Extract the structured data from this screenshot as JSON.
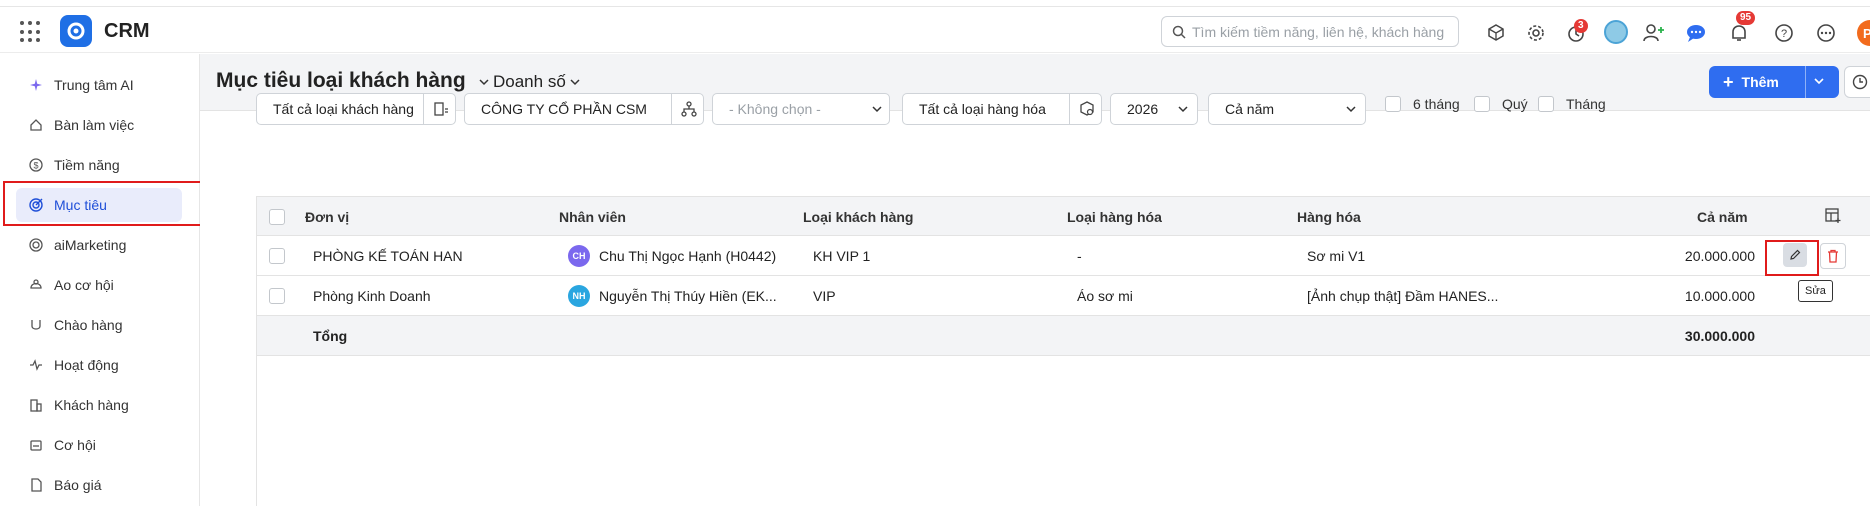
{
  "app": {
    "name": "CRM"
  },
  "search": {
    "placeholder": "Tìm kiếm tiềm năng, liên hệ, khách hàng"
  },
  "header_badges": {
    "timer": "3",
    "notifications": "95"
  },
  "user": {
    "initial": "P"
  },
  "sidebar": {
    "items": [
      {
        "label": "Trung tâm AI",
        "icon": "sparkle-icon"
      },
      {
        "label": "Bàn làm việc",
        "icon": "home-icon"
      },
      {
        "label": "Tiềm năng",
        "icon": "dollar-circle-icon"
      },
      {
        "label": "Mục tiêu",
        "icon": "target-icon",
        "active": true
      },
      {
        "label": "aiMarketing",
        "icon": "marketing-icon"
      },
      {
        "label": "Ao cơ hội",
        "icon": "pool-icon"
      },
      {
        "label": "Chào hàng",
        "icon": "offer-icon"
      },
      {
        "label": "Hoạt động",
        "icon": "activity-icon"
      },
      {
        "label": "Khách hàng",
        "icon": "building-icon"
      },
      {
        "label": "Cơ hội",
        "icon": "opportunity-icon"
      },
      {
        "label": "Báo giá",
        "icon": "quote-icon"
      }
    ]
  },
  "page": {
    "title": "Mục tiêu loại khách hàng",
    "metric": "Doanh số",
    "add_label": "Thêm"
  },
  "filters": {
    "customer_type": "Tất cả loại khách hàng",
    "company": "CÔNG TY CỔ PHẦN CSM",
    "unit_placeholder": "- Không chọn -",
    "product_type": "Tất cả loại hàng hóa",
    "year": "2026",
    "period": "Cả năm",
    "six_months": "6 tháng",
    "quarter": "Quý",
    "month": "Tháng"
  },
  "table": {
    "columns": [
      "Đơn vị",
      "Nhân viên",
      "Loại khách hàng",
      "Loại hàng hóa",
      "Hàng hóa",
      "Cả năm"
    ],
    "rows": [
      {
        "unit": "PHÒNG KẾ TOÁN HAN",
        "employee_initials": "CH",
        "employee": "Chu Thị Ngọc Hạnh (H0442)",
        "customer_type": "KH VIP 1",
        "product_type": "-",
        "product": "Sơ mi V1",
        "year_total": "20.000.000",
        "avatar_color": "#7b68ee"
      },
      {
        "unit": "Phòng Kinh Doanh",
        "employee_initials": "NH",
        "employee": "Nguyễn Thị Thúy Hiền (EK...",
        "customer_type": "VIP",
        "product_type": "Áo sơ mi",
        "product": "[Ảnh chụp thật] Đầm HANES...",
        "year_total": "10.000.000",
        "avatar_color": "#2aa6e0"
      }
    ],
    "total_label": "Tổng",
    "total_value": "30.000.000"
  },
  "tooltip": {
    "edit": "Sửa"
  },
  "colors": {
    "primary": "#2f6df0",
    "active_bg": "#e9ecfb",
    "highlight": "#e01b1b",
    "danger": "#e53935"
  }
}
